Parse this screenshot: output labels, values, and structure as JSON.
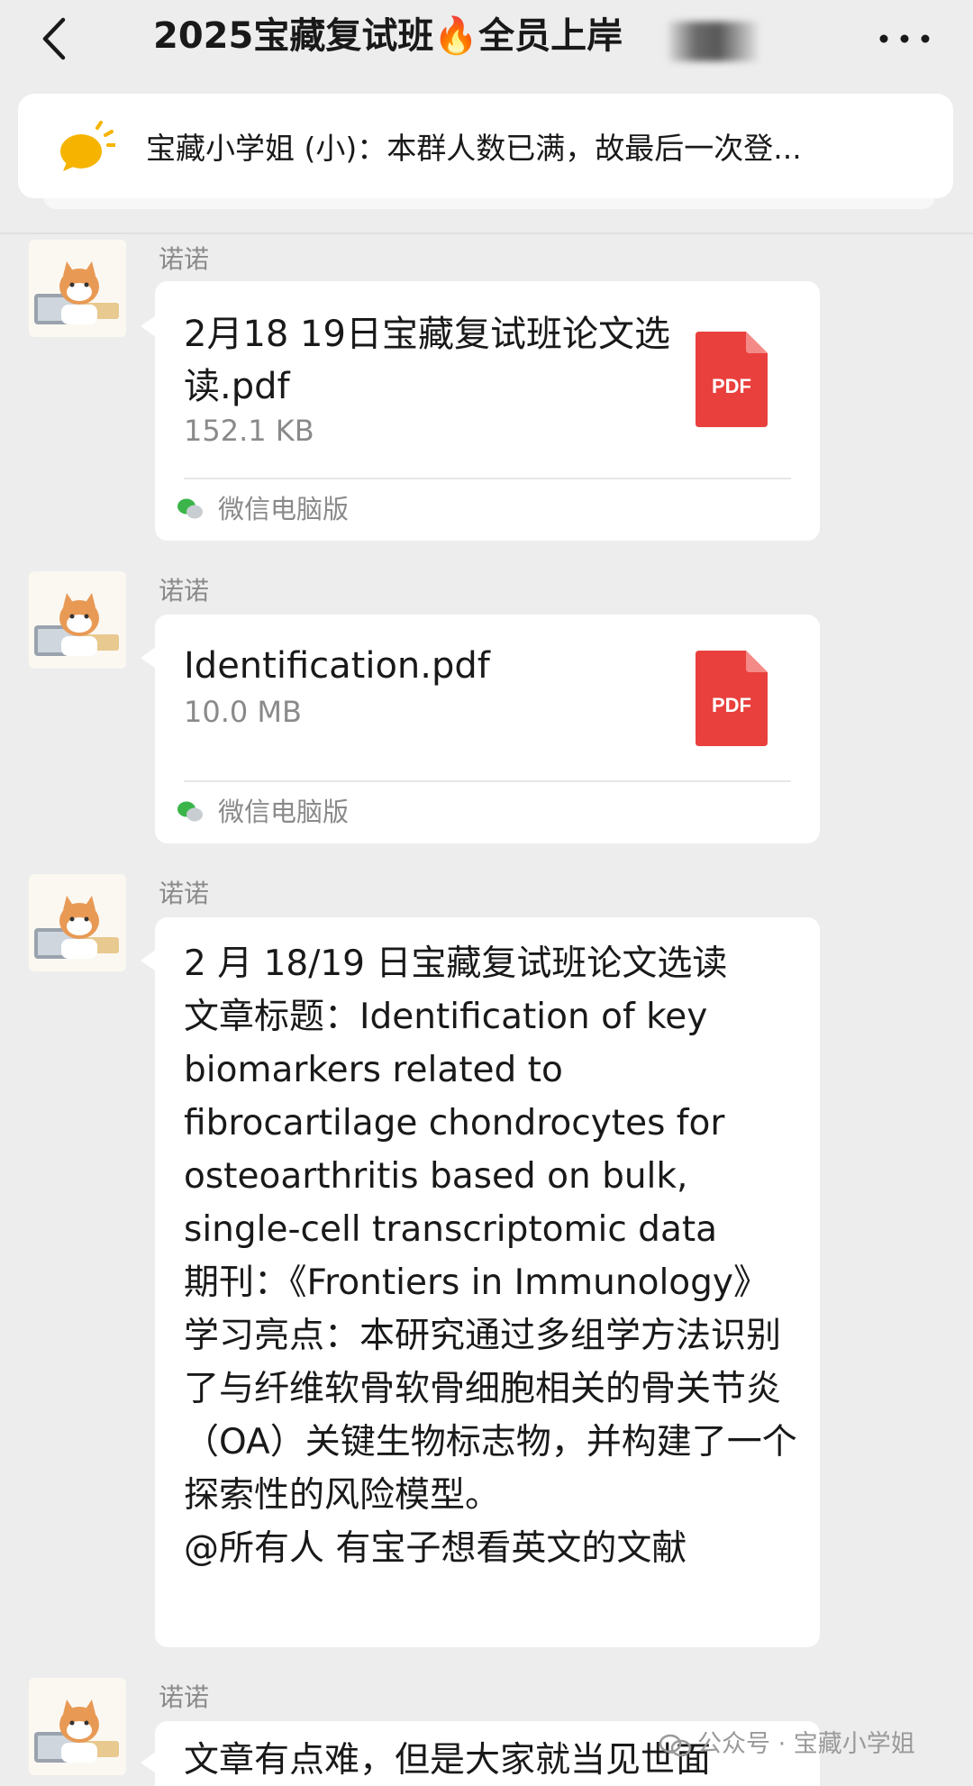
{
  "header": {
    "title": "2025宝藏复试班🔥全员上岸",
    "back_icon": "back-arrow-icon",
    "more_icon": "more-dots-icon"
  },
  "announcement": {
    "icon": "bulb-icon",
    "text": "宝藏小学姐 (小)：本群人数已满，故最后一次登..."
  },
  "messages": [
    {
      "sender": "诺诺",
      "type": "file",
      "file_name": "2月18 19日宝藏复试班论文选读.pdf",
      "file_size": "152.1 KB",
      "file_icon_label": "PDF",
      "source": "微信电脑版"
    },
    {
      "sender": "诺诺",
      "type": "file",
      "file_name": "Identification.pdf",
      "file_size": "10.0 MB",
      "file_icon_label": "PDF",
      "source": "微信电脑版"
    },
    {
      "sender": "诺诺",
      "type": "text",
      "text": "2 月 18/19 日宝藏复试班论文选读\n文章标题：Identification of key biomarkers related to fibrocartilage chondrocytes for osteoarthritis based on bulk, single-cell transcriptomic data\n期刊：《Frontiers in Immunology》\n学习亮点：本研究通过多组学方法识别了与纤维软骨软骨细胞相关的骨关节炎（OA）关键生物标志物，并构建了一个探索性的风险模型。\n@所有人  有宝子想看英文的文献"
    },
    {
      "sender": "诺诺",
      "type": "text",
      "text": "文章有点难，但是大家就当见世面"
    }
  ],
  "watermark": {
    "text": "公众号 · 宝藏小学姐"
  },
  "colors": {
    "background": "#ededed",
    "bubble": "#ffffff",
    "pdf_red": "#e9403d",
    "bulb": "#f6b400",
    "wechat_green": "#3bb54a"
  }
}
